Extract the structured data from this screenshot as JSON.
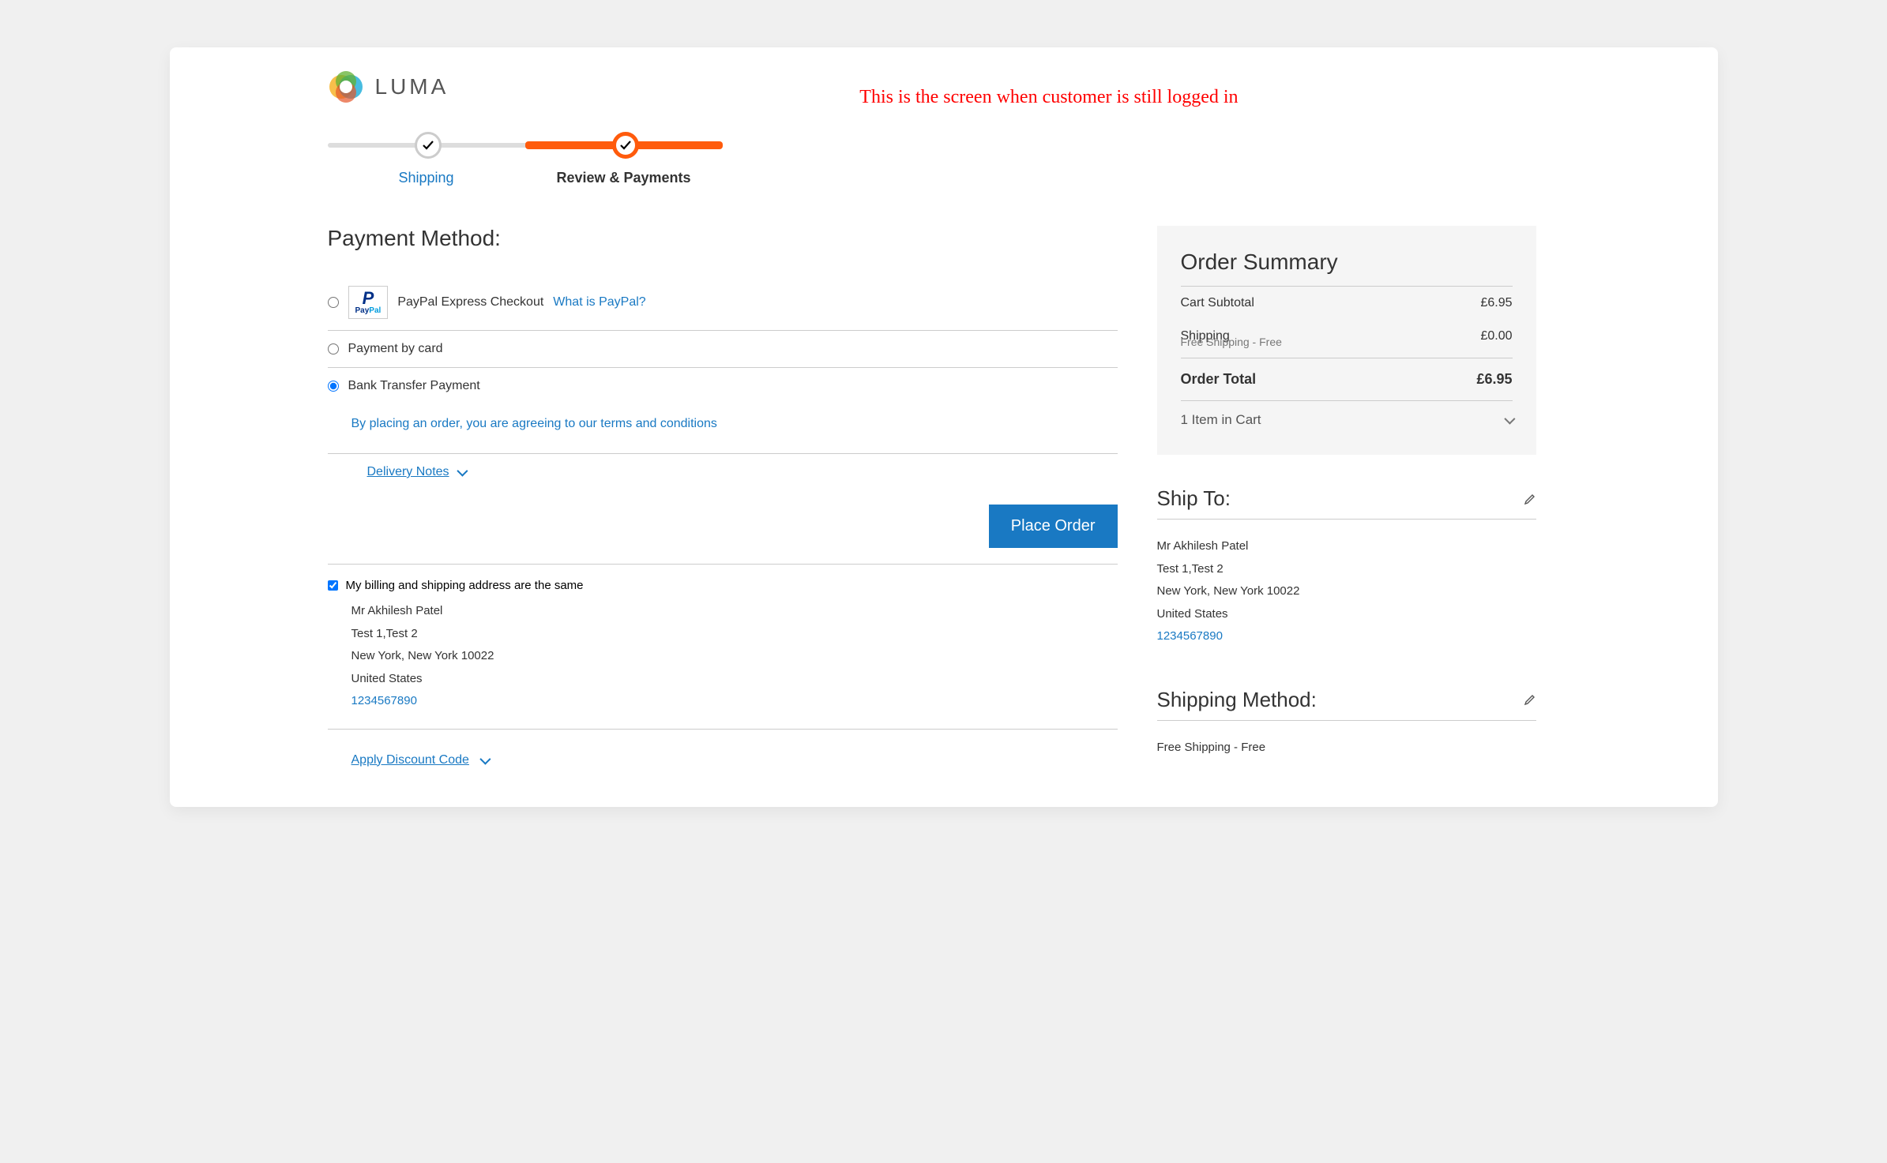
{
  "annotation": "This is the screen when customer is still logged in",
  "brand": {
    "name": "LUMA"
  },
  "progress": {
    "step1_label": "Shipping",
    "step2_label": "Review & Payments"
  },
  "payment": {
    "heading": "Payment Method:",
    "options": {
      "paypal": {
        "label": "PayPal Express Checkout",
        "help_link": "What is PayPal?"
      },
      "card": {
        "label": "Payment by card"
      },
      "bank": {
        "label": "Bank Transfer Payment"
      }
    },
    "terms_text": "By placing an order, you are agreeing to our terms and conditions",
    "delivery_notes_label": "Delivery Notes",
    "place_order_label": "Place Order",
    "same_address_label": "My billing and shipping address are the same",
    "billing_address": {
      "name": "Mr Akhilesh Patel",
      "street": "Test 1,Test 2",
      "city_line": "New York, New York 10022",
      "country": "United States",
      "phone": "1234567890"
    },
    "discount_label": "Apply Discount Code"
  },
  "summary": {
    "title": "Order Summary",
    "subtotal_label": "Cart Subtotal",
    "subtotal_value": "£6.95",
    "shipping_label": "Shipping",
    "shipping_sub": "Free Shipping - Free",
    "shipping_value": "£0.00",
    "total_label": "Order Total",
    "total_value": "£6.95",
    "items_label": "1 Item in Cart"
  },
  "ship_to": {
    "title": "Ship To:",
    "name": "Mr Akhilesh Patel",
    "street": "Test 1,Test 2",
    "city_line": "New York, New York 10022",
    "country": "United States",
    "phone": "1234567890"
  },
  "shipping_method": {
    "title": "Shipping Method:",
    "value": "Free Shipping - Free"
  }
}
